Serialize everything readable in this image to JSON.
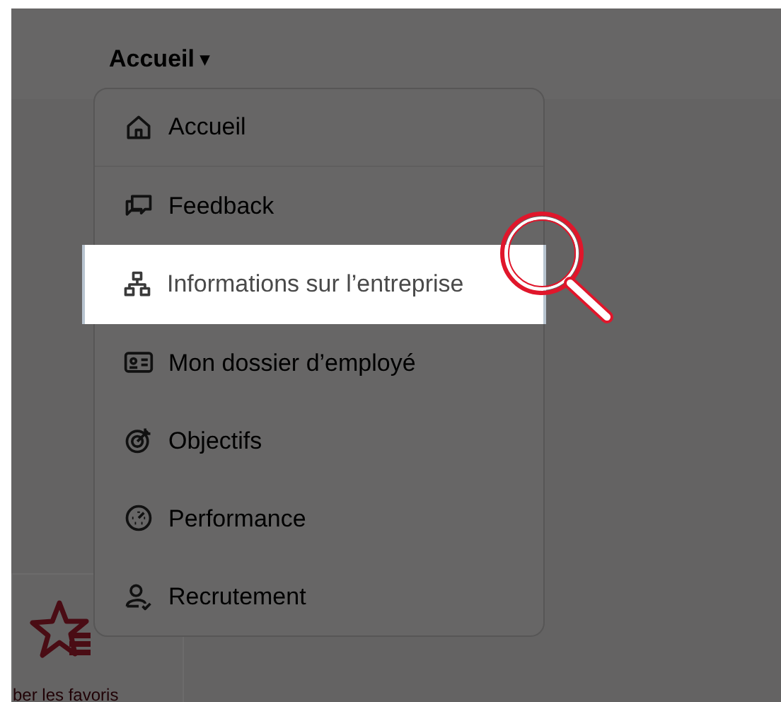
{
  "header": {
    "title": "Accueil",
    "caret": "▾"
  },
  "menu": {
    "items": [
      {
        "label": "Accueil",
        "selected": false
      },
      {
        "label": "Feedback",
        "selected": false
      },
      {
        "label": "Informations sur l’entreprise",
        "selected": true
      },
      {
        "label": "Mon dossier d’employé",
        "selected": false
      },
      {
        "label": "Objectifs",
        "selected": false
      },
      {
        "label": "Performance",
        "selected": false
      },
      {
        "label": "Recrutement",
        "selected": false
      }
    ]
  },
  "favorites": {
    "label": "ber les favoris"
  }
}
